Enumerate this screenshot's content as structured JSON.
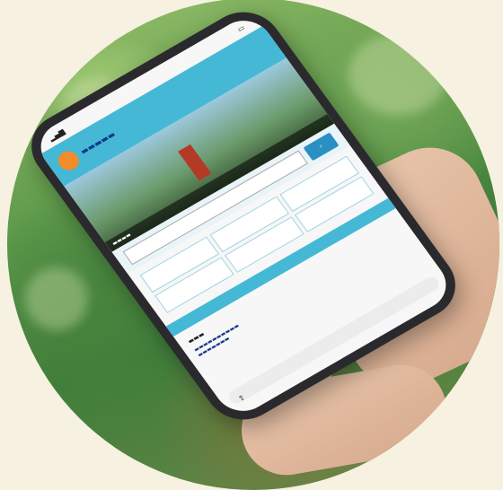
{
  "scene": {
    "description_free": true,
    "background_color": "#f6f1e0",
    "accent_color": "#45b8d6"
  },
  "phone": {
    "icons": [
      "signal-icon",
      "battery-icon",
      "search-icon",
      "share-icon"
    ]
  }
}
